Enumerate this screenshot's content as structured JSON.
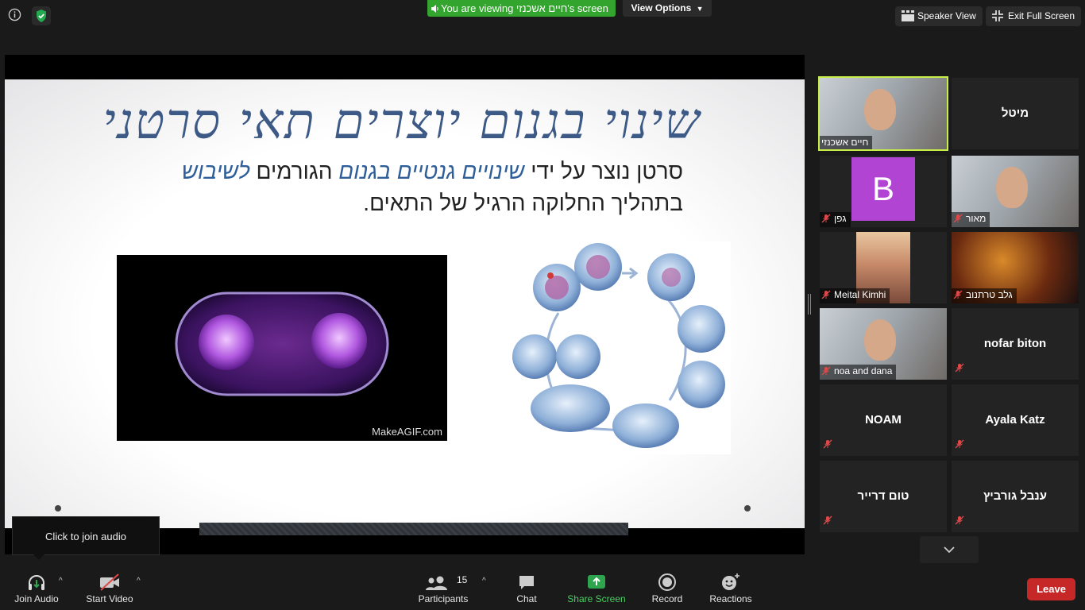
{
  "top_bar": {
    "viewing_banner": "You are viewing חיים אשכנזי's screen",
    "view_options": "View Options",
    "speaker_view": "Speaker View",
    "exit_full_screen": "Exit Full Screen"
  },
  "slide": {
    "title": "שינוי בגנום יוצרים תאי סרטני",
    "body_line1_prefix": "סרטן נוצר על ידי",
    "body_line1_hl1": "שינויים גנטיים בגנום",
    "body_line1_mid": "הגורמים",
    "body_line1_hl2": "לשיבוש",
    "body_line2": "בתהליך החלוקה הרגיל של התאים.",
    "gif_credit": "MakeAGIF.com"
  },
  "participants": [
    {
      "name": "חיים אשכנזי",
      "type": "video",
      "active": true
    },
    {
      "name": "מיטל",
      "type": "name"
    },
    {
      "name": "גפן",
      "type": "avatar",
      "initial": "B",
      "muted": true
    },
    {
      "name": "מאור",
      "type": "video",
      "muted": true
    },
    {
      "name": "Meital Kimhi",
      "type": "photo",
      "muted": true
    },
    {
      "name": "גלב טרתנוב",
      "type": "photo",
      "muted": true
    },
    {
      "name": "noa and dana",
      "type": "video",
      "muted": true
    },
    {
      "name": "nofar biton",
      "type": "name",
      "muted": true
    },
    {
      "name": "NOAM",
      "type": "name",
      "muted": true
    },
    {
      "name": "Ayala Katz",
      "type": "name",
      "muted": true
    },
    {
      "name": "טום דרייר",
      "type": "name",
      "muted": true
    },
    {
      "name": "ענבל גורביץ",
      "type": "name",
      "muted": true
    }
  ],
  "tooltip": "Click to join audio",
  "bottom_bar": {
    "join_audio": "Join Audio",
    "start_video": "Start Video",
    "participants": "Participants",
    "participants_count": "15",
    "chat": "Chat",
    "share_screen": "Share Screen",
    "record": "Record",
    "reactions": "Reactions",
    "leave": "Leave"
  },
  "colors": {
    "share_green": "#33a52f",
    "active_outline": "#c8ee4a",
    "leave_red": "#c62828",
    "muted_red": "#e04848",
    "avatar_purple": "#b144d2"
  }
}
